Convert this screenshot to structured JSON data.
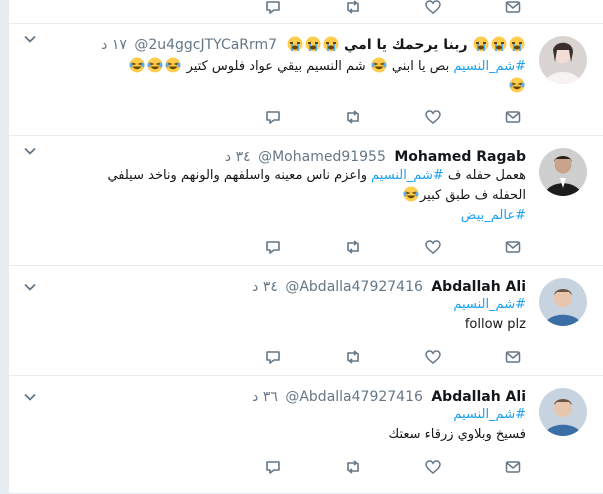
{
  "tweets": [
    {
      "name": "",
      "username": "",
      "time": "",
      "lines": []
    },
    {
      "name": "ربنا يرحمك يا امي",
      "username": "@2u4ggcJTYCaRrm7",
      "time": "١٧ د",
      "lines": [
        {
          "pre": "",
          "tag": "#شم_النسيم",
          "post": " بص يا ابني ",
          "emoji_after": "laughing-tears",
          "post2": " شم النسيم بيقي عواد فلوس كتير "
        },
        {
          "pre": "",
          "tag": "",
          "post": "",
          "emoji_after": "laughing-tears"
        }
      ]
    },
    {
      "name": "Mohamed Ragab",
      "username": "@Mohamed91955",
      "time": "٣٤ د",
      "lines": [
        {
          "pre": "هعمل حفله ف ",
          "tag": "#شم_النسيم",
          "post": " واعزم ناس معينه واسلفهم والونهم وناخد سيلفي"
        },
        {
          "pre": "الحفله ف طبق كبير",
          "tag": "",
          "post": ""
        },
        {
          "pre": "",
          "tag": "#عالم_بيض",
          "post": ""
        }
      ]
    },
    {
      "name": "Abdallah Ali",
      "username": "@Abdalla47927416",
      "time": "٣٤ د",
      "lines": [
        {
          "pre": "",
          "tag": "#شم_النسيم",
          "post": ""
        },
        {
          "pre": "follow plz",
          "tag": "",
          "post": ""
        }
      ]
    },
    {
      "name": "Abdallah Ali",
      "username": "@Abdalla47927416",
      "time": "٣٦ د",
      "lines": [
        {
          "pre": "",
          "tag": "#شم_النسيم",
          "post": ""
        },
        {
          "pre": "فسيخ وبلاوي زرقاء سعتك",
          "tag": "",
          "post": ""
        }
      ]
    }
  ],
  "colors": {
    "accent": "#1da1f2",
    "icon": "#657786",
    "separator": "#e6ecf0",
    "emoji_face": "#ffcc4d",
    "emoji_tear": "#5dadec"
  },
  "icons": [
    "reply-icon",
    "retweet-icon",
    "like-icon",
    "direct-message-icon",
    "chevron-down-icon",
    "laughing-tears-emoji",
    "crying-emoji"
  ]
}
